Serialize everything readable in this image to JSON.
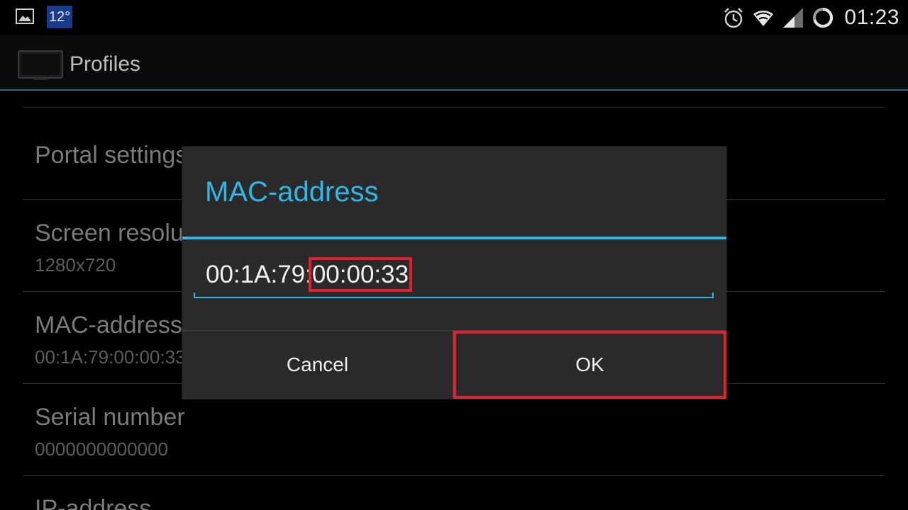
{
  "status_bar": {
    "weather": "12°",
    "clock": "01:23",
    "icons": [
      "image-icon",
      "alarm-icon",
      "wifi-icon",
      "signal-icon",
      "sync-icon"
    ]
  },
  "action_bar": {
    "title": "Profiles",
    "icon": "tv-icon"
  },
  "preferences": [
    {
      "title": "Portal settings",
      "summary": ""
    },
    {
      "title": "Screen resolution",
      "summary": "1280x720"
    },
    {
      "title": "MAC-address",
      "summary": "00:1A:79:00:00:33"
    },
    {
      "title": "Serial number",
      "summary": "0000000000000"
    },
    {
      "title": "IP-address",
      "summary": ""
    }
  ],
  "dialog": {
    "title": "MAC-address",
    "value_prefix": "00:1A:79:",
    "value_highlight": "00:00:33",
    "cancel_label": "Cancel",
    "ok_label": "OK"
  },
  "colors": {
    "accent": "#33b5e5",
    "highlight": "#e0212f"
  }
}
